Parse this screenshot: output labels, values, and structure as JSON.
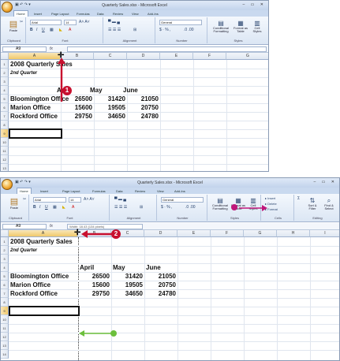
{
  "shot1": {
    "window_title": "Quarterly Sales.xlsx - Microsoft Excel",
    "tabs": [
      "Home",
      "Insert",
      "Page Layout",
      "Formulas",
      "Data",
      "Review",
      "View",
      "Add-Ins"
    ],
    "ribbon": {
      "font_name": "Arial",
      "font_size": "14",
      "number_format": "General",
      "groups": [
        "Clipboard",
        "Font",
        "Alignment",
        "Number",
        "Styles"
      ],
      "paste_label": "Paste",
      "cond_format_label": "Conditional Formatting",
      "format_table_label": "Format as Table",
      "cell_styles_label": "Cell Styles"
    },
    "name_box": "A9",
    "fx_label": "fx",
    "formula_value": "",
    "columns": [
      "A",
      "B",
      "C",
      "D",
      "E",
      "F",
      "G"
    ],
    "rows": [
      "1",
      "2",
      "3",
      "4",
      "5",
      "6",
      "7",
      "8",
      "9",
      "10",
      "11",
      "12",
      "13",
      "14"
    ],
    "callout": "1"
  },
  "shot2": {
    "window_title": "Quarterly Sales.xlsx - Microsoft Excel",
    "tabs": [
      "Home",
      "Insert",
      "Page Layout",
      "Formulas",
      "Data",
      "Review",
      "View",
      "Add-Ins"
    ],
    "ribbon": {
      "font_name": "Arial",
      "font_size": "14",
      "number_format": "General",
      "groups": [
        "Clipboard",
        "Font",
        "Alignment",
        "Number",
        "Styles",
        "Cells",
        "Editing"
      ],
      "paste_label": "Paste",
      "cond_format_label": "Conditional Formatting",
      "format_table_label": "Format as Table",
      "cell_styles_label": "Cell Styles",
      "insert_label": "Insert",
      "delete_label": "Delete",
      "format_label": "Format",
      "sort_label": "Sort & Filter",
      "find_label": "Find & Select"
    },
    "name_box": "A9",
    "fx_label": "fx",
    "formula_value": "Width: 18.43 (134 pixels)",
    "columns": [
      "A",
      "B",
      "C",
      "D",
      "E",
      "F",
      "G",
      "H",
      "I"
    ],
    "rows": [
      "1",
      "2",
      "3",
      "4",
      "5",
      "6",
      "7",
      "8",
      "9",
      "10",
      "11",
      "12",
      "13",
      "14"
    ],
    "callout": "2"
  },
  "sheet": {
    "title": "2008 Quarterly Sales",
    "subtitle": "2nd Quarter",
    "headers": [
      "April",
      "May",
      "June"
    ],
    "offices": [
      {
        "name": "Bloomington Office",
        "values": [
          "26500",
          "31420",
          "21050"
        ]
      },
      {
        "name": "Marion Office",
        "values": [
          "15600",
          "19505",
          "20750"
        ]
      },
      {
        "name": "Rockford Office",
        "values": [
          "29750",
          "34650",
          "24780"
        ]
      }
    ]
  },
  "colors": {
    "callout_red": "#c8102e",
    "arrow_green": "#6cbf3c",
    "dot_magenta": "#c0167a",
    "selection_gold": "#f1c96a"
  },
  "icons": [
    "office-button-icon",
    "save-icon",
    "undo-icon",
    "redo-icon",
    "bold-icon",
    "italic-icon",
    "underline-icon",
    "borders-icon",
    "fill-color-icon",
    "font-color-icon",
    "align-left-icon",
    "align-center-icon",
    "align-right-icon",
    "merge-icon",
    "currency-icon",
    "percent-icon",
    "comma-icon",
    "column-resize-cursor-icon",
    "function-icon"
  ]
}
